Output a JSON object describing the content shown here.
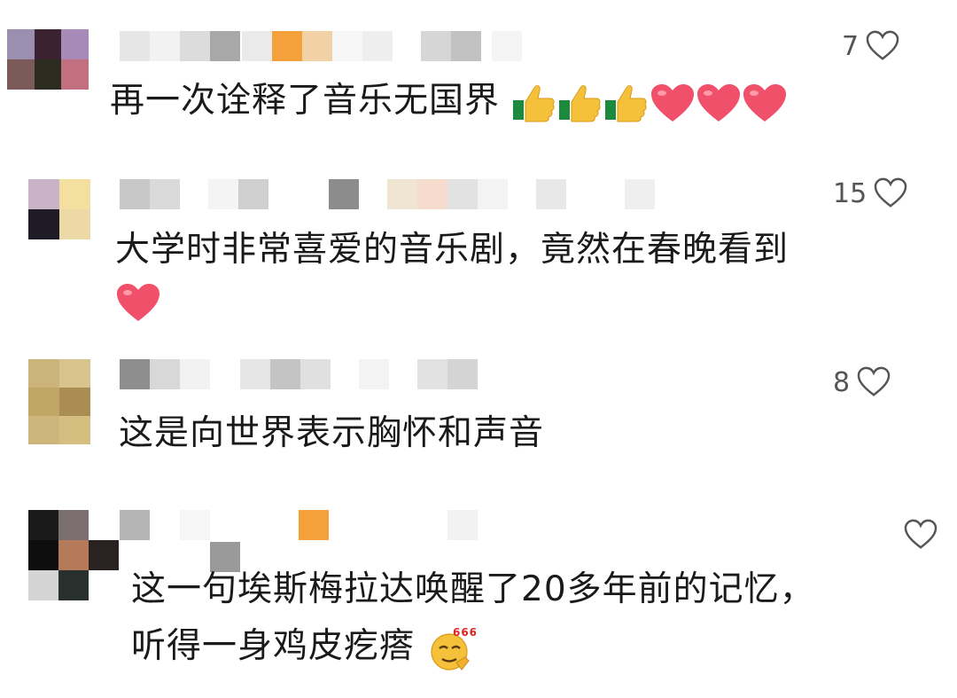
{
  "comments": [
    {
      "text": "再一次诠释了音乐无国界",
      "likes": "7",
      "emojis": [
        "thumbs-up",
        "thumbs-up",
        "thumbs-up",
        "red-heart",
        "red-heart",
        "red-heart"
      ]
    },
    {
      "text": "大学时非常喜爱的音乐剧，竟然在春晚看到",
      "likes": "15",
      "emojis": [
        "red-heart"
      ]
    },
    {
      "text": "这是向世界表示胸怀和声音",
      "likes": "8",
      "emojis": []
    },
    {
      "text_line1": "这一句埃斯梅拉达唤醒了20多年前的记忆，",
      "text_line2": "听得一身鸡皮疙瘩",
      "likes": "",
      "emojis": [
        "666-face"
      ]
    }
  ],
  "colors": {
    "accent_orange": "#f4a13c",
    "heart_red": "#f0506a",
    "thumb_yellow": "#f6c13a",
    "outline_gray": "#555555"
  }
}
